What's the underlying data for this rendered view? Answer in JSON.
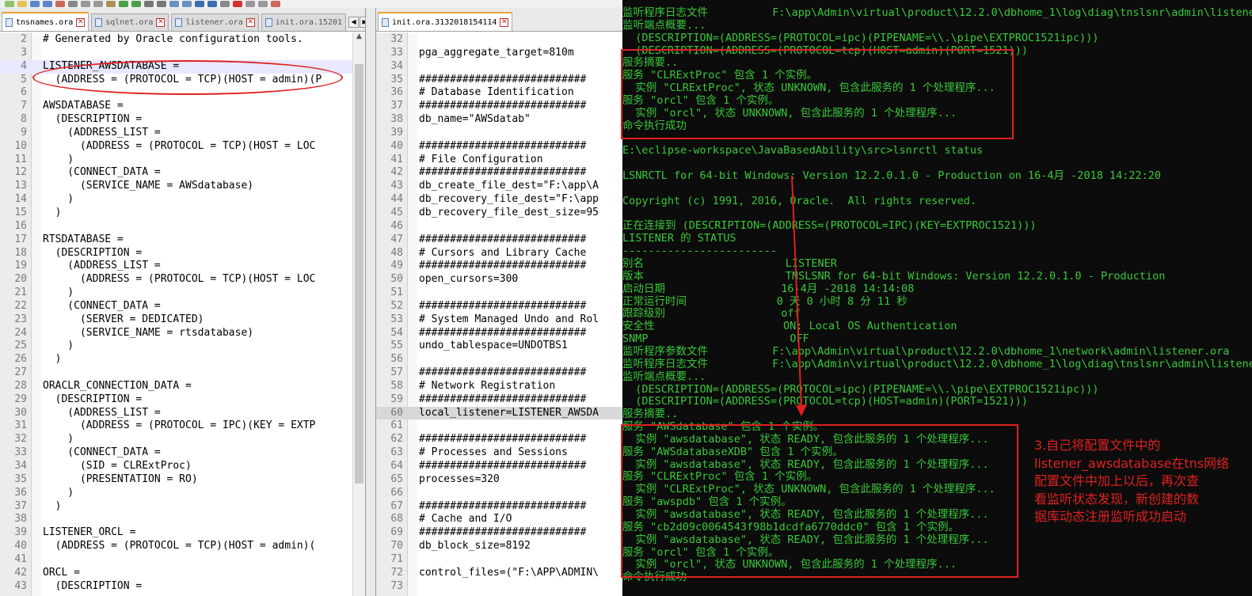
{
  "colors": {
    "console_green": "#39c839",
    "annotation_red": "#e02020"
  },
  "left_pane": {
    "tabs": [
      {
        "label": "tnsnames.ora",
        "active": true
      },
      {
        "label": "sqlnet.ora",
        "active": false
      },
      {
        "label": "listener.ora",
        "active": false
      },
      {
        "label": "init.ora.15201",
        "active": false
      }
    ],
    "lines": [
      {
        "n": "2",
        "t": "# Generated by Oracle configuration tools."
      },
      {
        "n": "3",
        "t": ""
      },
      {
        "n": "4",
        "t": "LISTENER_AWSDATABASE ="
      },
      {
        "n": "5",
        "t": "  (ADDRESS = (PROTOCOL = TCP)(HOST = admin)(P"
      },
      {
        "n": "6",
        "t": ""
      },
      {
        "n": "7",
        "t": "AWSDATABASE ="
      },
      {
        "n": "8",
        "t": "  (DESCRIPTION ="
      },
      {
        "n": "9",
        "t": "    (ADDRESS_LIST ="
      },
      {
        "n": "10",
        "t": "      (ADDRESS = (PROTOCOL = TCP)(HOST = LOC"
      },
      {
        "n": "11",
        "t": "    )"
      },
      {
        "n": "12",
        "t": "    (CONNECT_DATA ="
      },
      {
        "n": "13",
        "t": "      (SERVICE_NAME = AWSdatabase)"
      },
      {
        "n": "14",
        "t": "    )"
      },
      {
        "n": "15",
        "t": "  )"
      },
      {
        "n": "16",
        "t": ""
      },
      {
        "n": "17",
        "t": "RTSDATABASE ="
      },
      {
        "n": "18",
        "t": "  (DESCRIPTION ="
      },
      {
        "n": "19",
        "t": "    (ADDRESS_LIST ="
      },
      {
        "n": "20",
        "t": "      (ADDRESS = (PROTOCOL = TCP)(HOST = LOC"
      },
      {
        "n": "21",
        "t": "    )"
      },
      {
        "n": "22",
        "t": "    (CONNECT_DATA ="
      },
      {
        "n": "23",
        "t": "      (SERVER = DEDICATED)"
      },
      {
        "n": "24",
        "t": "      (SERVICE_NAME = rtsdatabase)"
      },
      {
        "n": "25",
        "t": "    )"
      },
      {
        "n": "26",
        "t": "  )"
      },
      {
        "n": "27",
        "t": ""
      },
      {
        "n": "28",
        "t": "ORACLR_CONNECTION_DATA ="
      },
      {
        "n": "29",
        "t": "  (DESCRIPTION ="
      },
      {
        "n": "30",
        "t": "    (ADDRESS_LIST ="
      },
      {
        "n": "31",
        "t": "      (ADDRESS = (PROTOCOL = IPC)(KEY = EXTP"
      },
      {
        "n": "32",
        "t": "    )"
      },
      {
        "n": "33",
        "t": "    (CONNECT_DATA ="
      },
      {
        "n": "34",
        "t": "      (SID = CLRExtProc)"
      },
      {
        "n": "35",
        "t": "      (PRESENTATION = RO)"
      },
      {
        "n": "36",
        "t": "    )"
      },
      {
        "n": "37",
        "t": "  )"
      },
      {
        "n": "38",
        "t": ""
      },
      {
        "n": "39",
        "t": "LISTENER_ORCL ="
      },
      {
        "n": "40",
        "t": "  (ADDRESS = (PROTOCOL = TCP)(HOST = admin)("
      },
      {
        "n": "41",
        "t": ""
      },
      {
        "n": "42",
        "t": "ORCL ="
      },
      {
        "n": "43",
        "t": "  (DESCRIPTION ="
      }
    ]
  },
  "mid_pane": {
    "tabs": [
      {
        "label": "init.ora.3132018154114",
        "active": true
      }
    ],
    "lines": [
      {
        "n": "32",
        "t": ""
      },
      {
        "n": "33",
        "t": "pga_aggregate_target=810m"
      },
      {
        "n": "34",
        "t": ""
      },
      {
        "n": "35",
        "t": "###########################"
      },
      {
        "n": "36",
        "t": "# Database Identification"
      },
      {
        "n": "37",
        "t": "###########################"
      },
      {
        "n": "38",
        "t": "db_name=\"AWSdatab\""
      },
      {
        "n": "39",
        "t": ""
      },
      {
        "n": "40",
        "t": "###########################"
      },
      {
        "n": "41",
        "t": "# File Configuration"
      },
      {
        "n": "42",
        "t": "###########################"
      },
      {
        "n": "43",
        "t": "db_create_file_dest=\"F:\\app\\A"
      },
      {
        "n": "44",
        "t": "db_recovery_file_dest=\"F:\\app"
      },
      {
        "n": "45",
        "t": "db_recovery_file_dest_size=95"
      },
      {
        "n": "46",
        "t": ""
      },
      {
        "n": "47",
        "t": "###########################"
      },
      {
        "n": "48",
        "t": "# Cursors and Library Cache"
      },
      {
        "n": "49",
        "t": "###########################"
      },
      {
        "n": "50",
        "t": "open_cursors=300"
      },
      {
        "n": "51",
        "t": ""
      },
      {
        "n": "52",
        "t": "###########################"
      },
      {
        "n": "53",
        "t": "# System Managed Undo and Rol"
      },
      {
        "n": "54",
        "t": "###########################"
      },
      {
        "n": "55",
        "t": "undo_tablespace=UNDOTBS1"
      },
      {
        "n": "56",
        "t": ""
      },
      {
        "n": "57",
        "t": "###########################"
      },
      {
        "n": "58",
        "t": "# Network Registration"
      },
      {
        "n": "59",
        "t": "###########################"
      },
      {
        "n": "60",
        "t": "local_listener=LISTENER_AWSDA"
      },
      {
        "n": "61",
        "t": ""
      },
      {
        "n": "62",
        "t": "###########################"
      },
      {
        "n": "63",
        "t": "# Processes and Sessions"
      },
      {
        "n": "64",
        "t": "###########################"
      },
      {
        "n": "65",
        "t": "processes=320"
      },
      {
        "n": "66",
        "t": ""
      },
      {
        "n": "67",
        "t": "###########################"
      },
      {
        "n": "68",
        "t": "# Cache and I/O"
      },
      {
        "n": "69",
        "t": "###########################"
      },
      {
        "n": "70",
        "t": "db_block_size=8192"
      },
      {
        "n": "71",
        "t": ""
      },
      {
        "n": "72",
        "t": "control_files=(\"F:\\APP\\ADMIN\\"
      },
      {
        "n": "73",
        "t": ""
      }
    ]
  },
  "console": {
    "lines": [
      "监听程序日志文件          F:\\app\\Admin\\virtual\\product\\12.2.0\\dbhome_1\\log\\diag\\tnslsnr\\admin\\listener\\alert\\log.xml",
      "监听端点概要...",
      "  (DESCRIPTION=(ADDRESS=(PROTOCOL=ipc)(PIPENAME=\\\\.\\pipe\\EXTPROC1521ipc)))",
      "  (DESCRIPTION=(ADDRESS=(PROTOCOL=tcp)(HOST=admin)(PORT=1521)))",
      "服务摘要..",
      "服务 \"CLRExtProc\" 包含 1 个实例。",
      "  实例 \"CLRExtProc\", 状态 UNKNOWN, 包含此服务的 1 个处理程序...",
      "服务 \"orcl\" 包含 1 个实例。",
      "  实例 \"orcl\", 状态 UNKNOWN, 包含此服务的 1 个处理程序...",
      "命令执行成功",
      "",
      "E:\\eclipse-workspace\\JavaBasedAbility\\src>lsnrctl status",
      "",
      "LSNRCTL for 64-bit Windows: Version 12.2.0.1.0 - Production on 16-4月 -2018 14:22:20",
      "",
      "Copyright (c) 1991, 2016, Oracle.  All rights reserved.",
      "",
      "正在连接到 (DESCRIPTION=(ADDRESS=(PROTOCOL=IPC)(KEY=EXTPROC1521)))",
      "LISTENER 的 STATUS",
      "------------------------",
      "别名                      LISTENER",
      "版本                      TNSLSNR for 64-bit Windows: Version 12.2.0.1.0 - Production",
      "启动日期                  16-4月 -2018 14:14:08",
      "正常运行时间              0 天 0 小时 8 分 11 秒",
      "跟踪级别                  off",
      "安全性                    ON: Local OS Authentication",
      "SNMP                      OFF",
      "监听程序参数文件          F:\\app\\Admin\\virtual\\product\\12.2.0\\dbhome_1\\network\\admin\\listener.ora",
      "监听程序日志文件          F:\\app\\Admin\\virtual\\product\\12.2.0\\dbhome_1\\log\\diag\\tnslsnr\\admin\\listener\\alert\\log.xml",
      "监听端点概要...",
      "  (DESCRIPTION=(ADDRESS=(PROTOCOL=ipc)(PIPENAME=\\\\.\\pipe\\EXTPROC1521ipc)))",
      "  (DESCRIPTION=(ADDRESS=(PROTOCOL=tcp)(HOST=admin)(PORT=1521)))",
      "服务摘要..",
      "服务 \"AWSdatabase\" 包含 1 个实例。",
      "  实例 \"awsdatabase\", 状态 READY, 包含此服务的 1 个处理程序...",
      "服务 \"AWSdatabaseXDB\" 包含 1 个实例。",
      "  实例 \"awsdatabase\", 状态 READY, 包含此服务的 1 个处理程序...",
      "服务 \"CLRExtProc\" 包含 1 个实例。",
      "  实例 \"CLRExtProc\", 状态 UNKNOWN, 包含此服务的 1 个处理程序...",
      "服务 \"awspdb\" 包含 1 个实例。",
      "  实例 \"awsdatabase\", 状态 READY, 包含此服务的 1 个处理程序...",
      "服务 \"cb2d09c0064543f98b1dcdfa6770ddc0\" 包含 1 个实例。",
      "  实例 \"awsdatabase\", 状态 READY, 包含此服务的 1 个处理程序...",
      "服务 \"orcl\" 包含 1 个实例。",
      "  实例 \"orcl\", 状态 UNKNOWN, 包含此服务的 1 个处理程序...",
      "命令执行成功"
    ]
  },
  "annotation": {
    "lines": [
      "3.自己将配置文件中的",
      "listener_awsdatabase在tns网络",
      "配置文件中加上以后，再次查",
      "看监听状态发现，新创建的数",
      "据库动态注册监听成功启动"
    ]
  }
}
